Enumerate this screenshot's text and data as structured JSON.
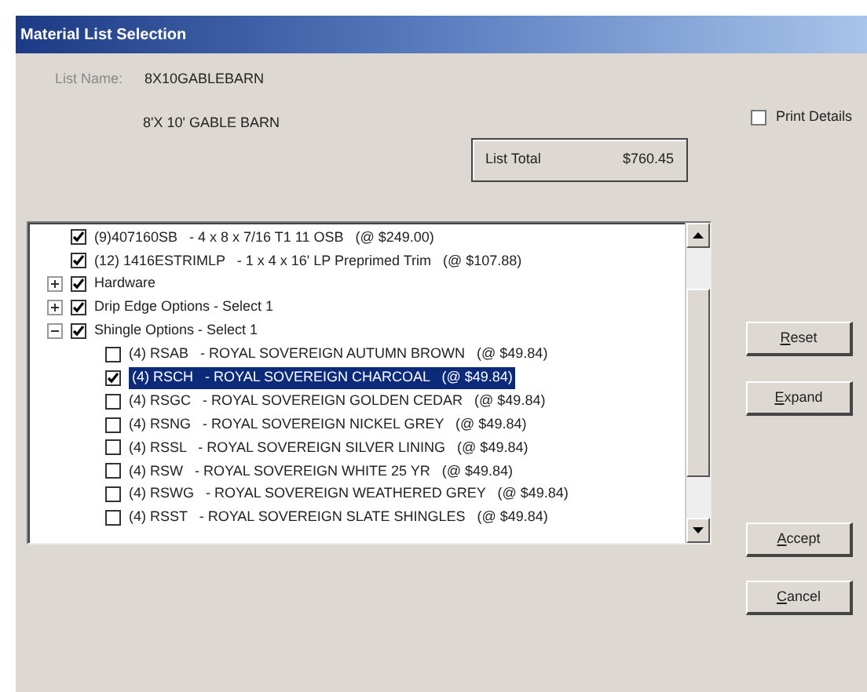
{
  "window": {
    "title": "Material List Selection"
  },
  "list_name": {
    "label": "List Name:",
    "value": "8X10GABLEBARN",
    "description": "8'X 10' GABLE BARN"
  },
  "print_details": {
    "label": "Print Details",
    "checked": false
  },
  "list_total": {
    "label": "List Total",
    "value": "$760.45"
  },
  "tree": [
    {
      "kind": "item",
      "checked": true,
      "selected": false,
      "code": "(9)407160SB",
      "text": "- 4 x 8 x 7/16 T1 11 OSB",
      "price": "(@ $249.00)"
    },
    {
      "kind": "item",
      "checked": true,
      "selected": false,
      "code": "(12) 1416ESTRIMLP",
      "text": "- 1 x 4 x 16' LP Preprimed Trim",
      "price": "(@ $107.88)"
    },
    {
      "kind": "group",
      "checked": true,
      "expanded": false,
      "selected": false,
      "text": "Hardware"
    },
    {
      "kind": "group",
      "checked": true,
      "expanded": false,
      "selected": false,
      "text": "Drip Edge Options - Select 1"
    },
    {
      "kind": "group",
      "checked": true,
      "expanded": true,
      "selected": false,
      "text": "Shingle Options - Select 1",
      "children": [
        {
          "kind": "item",
          "checked": false,
          "selected": false,
          "code": "(4) RSAB",
          "text": "- ROYAL SOVEREIGN AUTUMN BROWN",
          "price": "(@ $49.84)"
        },
        {
          "kind": "item",
          "checked": true,
          "selected": true,
          "code": "(4) RSCH",
          "text": "- ROYAL SOVEREIGN CHARCOAL",
          "price": "(@ $49.84)"
        },
        {
          "kind": "item",
          "checked": false,
          "selected": false,
          "code": "(4) RSGC",
          "text": "- ROYAL SOVEREIGN GOLDEN CEDAR",
          "price": "(@ $49.84)"
        },
        {
          "kind": "item",
          "checked": false,
          "selected": false,
          "code": "(4) RSNG",
          "text": "- ROYAL SOVEREIGN NICKEL GREY",
          "price": "(@ $49.84)"
        },
        {
          "kind": "item",
          "checked": false,
          "selected": false,
          "code": "(4) RSSL",
          "text": "- ROYAL SOVEREIGN SILVER LINING",
          "price": "(@ $49.84)"
        },
        {
          "kind": "item",
          "checked": false,
          "selected": false,
          "code": "(4) RSW",
          "text": "- ROYAL SOVEREIGN WHITE 25 YR",
          "price": "(@ $49.84)"
        },
        {
          "kind": "item",
          "checked": false,
          "selected": false,
          "code": "(4) RSWG",
          "text": "- ROYAL SOVEREIGN WEATHERED GREY",
          "price": "(@ $49.84)"
        },
        {
          "kind": "item",
          "checked": false,
          "selected": false,
          "code": "(4) RSST",
          "text": "- ROYAL SOVEREIGN SLATE SHINGLES",
          "price": "(@ $49.84)"
        }
      ]
    }
  ],
  "buttons_top": [
    {
      "key": "R",
      "rest": "eset"
    },
    {
      "key": "E",
      "rest": "xpand"
    }
  ],
  "buttons_bottom": [
    {
      "key": "A",
      "rest": "ccept"
    },
    {
      "key": "C",
      "rest": "ancel"
    }
  ]
}
